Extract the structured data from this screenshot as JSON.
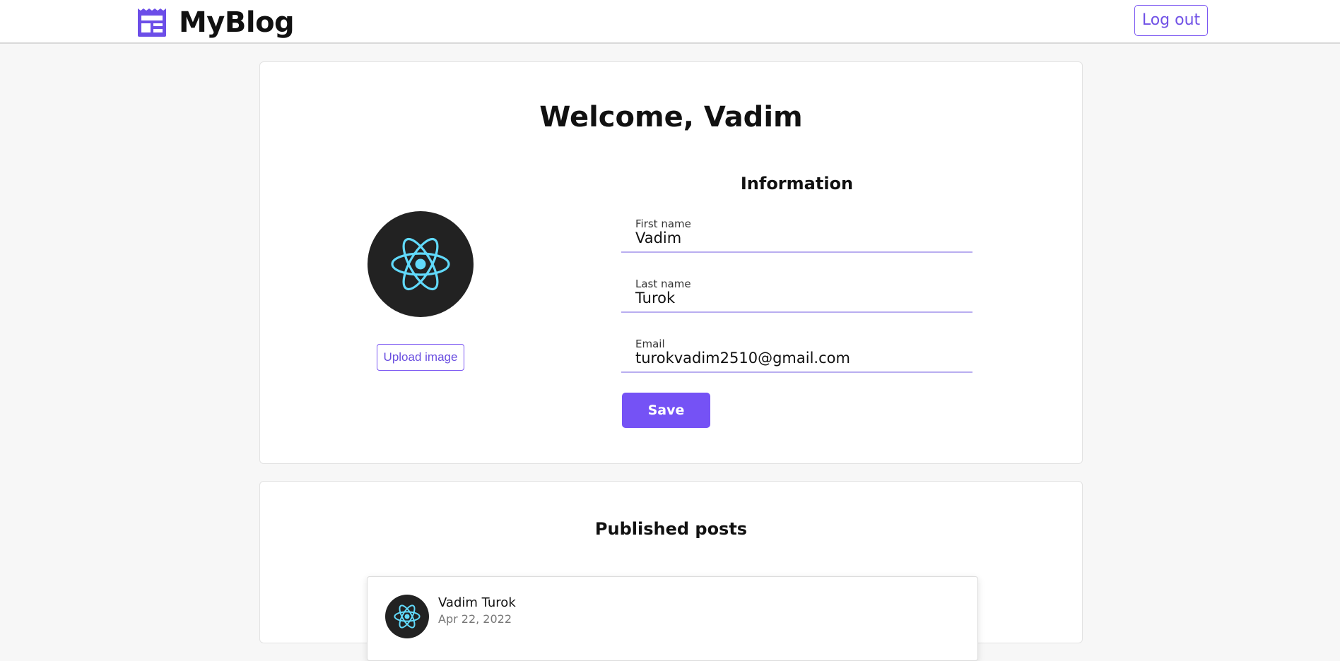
{
  "header": {
    "brand": "MyBlog",
    "logout_label": "Log out"
  },
  "profile": {
    "welcome": "Welcome, Vadim",
    "upload_label": "Upload image",
    "info_title": "Information",
    "fields": [
      {
        "label": "First name",
        "value": "Vadim"
      },
      {
        "label": "Last name",
        "value": "Turok"
      },
      {
        "label": "Email",
        "value": "turokvadim2510@gmail.com"
      }
    ],
    "save_label": "Save"
  },
  "posts": {
    "title": "Published posts",
    "items": [
      {
        "author": "Vadim Turok",
        "date": "Apr 22, 2022"
      }
    ]
  },
  "colors": {
    "accent": "#7552f5",
    "react_blue": "#61dafb",
    "avatar_bg": "#222222"
  },
  "icons": {
    "logo": "newspaper-icon",
    "avatar": "react-logo-icon"
  }
}
